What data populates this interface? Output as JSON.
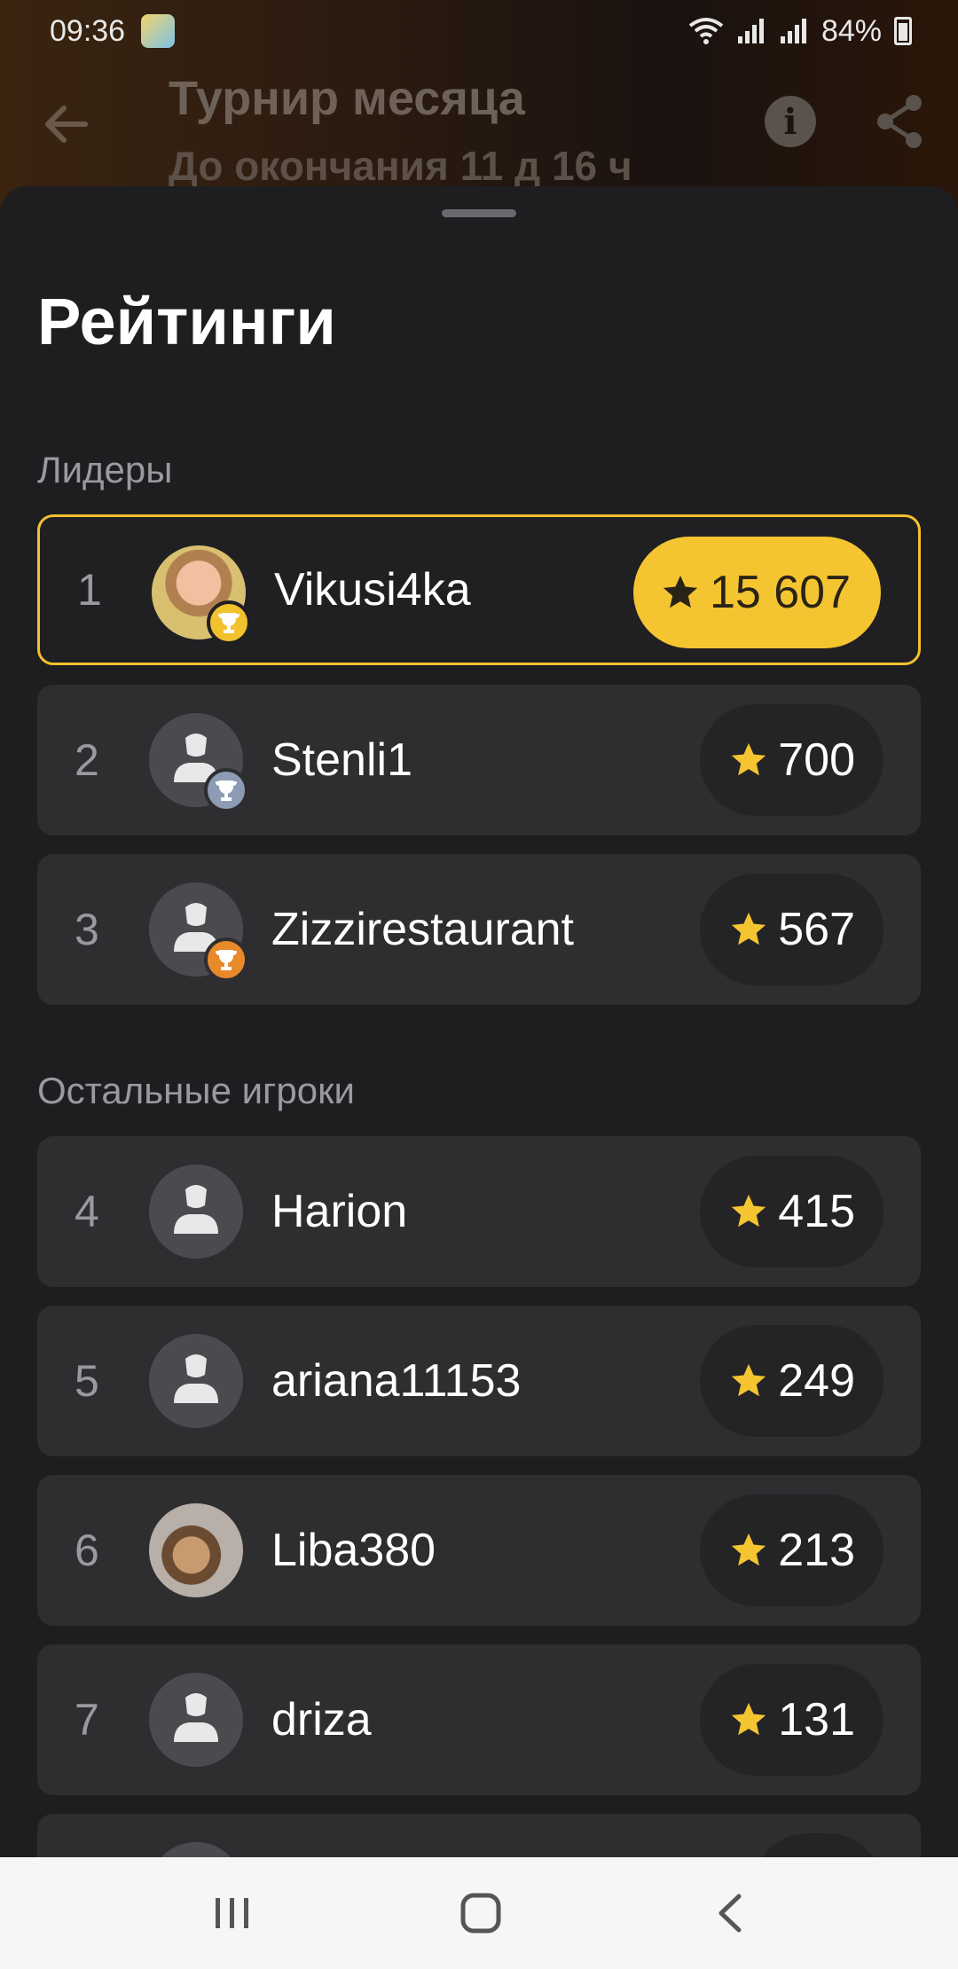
{
  "status_bar": {
    "time": "09:36",
    "battery": "84%"
  },
  "app_bar": {
    "title": "Турнир месяца",
    "subtitle": "До окончания 11 д 16 ч"
  },
  "sheet": {
    "title": "Рейтинги",
    "leaders_label": "Лидеры",
    "others_label": "Остальные игроки"
  },
  "leaders": [
    {
      "rank": "1",
      "name": "Vikusi4ka",
      "score": "15 607",
      "trophy_color": "#f2c12e"
    },
    {
      "rank": "2",
      "name": "Stenli1",
      "score": "700",
      "trophy_color": "#8e9bb4"
    },
    {
      "rank": "3",
      "name": "Zizzirestaurant",
      "score": "567",
      "trophy_color": "#e98a2a"
    }
  ],
  "others": [
    {
      "rank": "4",
      "name": "Harion",
      "score": "415"
    },
    {
      "rank": "5",
      "name": "ariana11153",
      "score": "249"
    },
    {
      "rank": "6",
      "name": "Liba380",
      "score": "213"
    },
    {
      "rank": "7",
      "name": "driza",
      "score": "131"
    }
  ],
  "colors": {
    "accent_gold": "#f5c431",
    "star": "#f5c431",
    "row_bg": "#2e2e31",
    "sheet_bg": "#1e1e20"
  },
  "icons": {
    "back": "arrow-left-icon",
    "info": "info-icon",
    "share": "share-icon",
    "star": "star-icon",
    "trophy": "trophy-icon",
    "default_avatar": "person-icon"
  }
}
